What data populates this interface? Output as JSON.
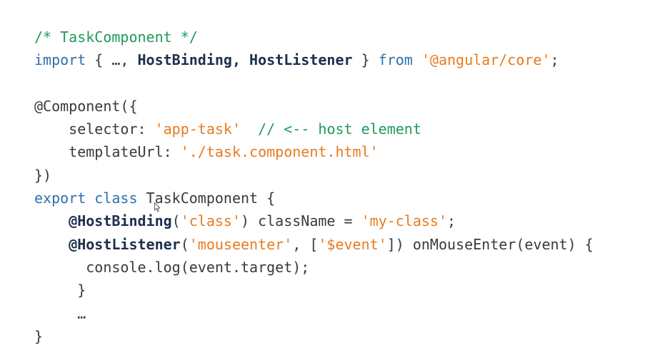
{
  "code": {
    "l1": {
      "comment": "/* TaskComponent */"
    },
    "l2": {
      "kw_import": "import",
      "brace_open": " { …, ",
      "host_binding": "HostBinding",
      "comma": ", ",
      "host_listener": "HostListener",
      "brace_close": " } ",
      "kw_from": "from",
      "space": " ",
      "module": "'@angular/core'",
      "semi": ";"
    },
    "l4": {
      "text": "@Component({"
    },
    "l5": {
      "indent": "    ",
      "key": "selector: ",
      "value": "'app-task'",
      "gap": "  ",
      "comment": "// <-- host element"
    },
    "l6": {
      "indent": "    ",
      "key": "templateUrl: ",
      "value": "'./task.component.html'"
    },
    "l7": {
      "text": "})"
    },
    "l8": {
      "kw_export": "export",
      "space1": " ",
      "kw_class": "class",
      "rest": " TaskComponent {"
    },
    "l9": {
      "indent": "    ",
      "decorator": "@HostBinding",
      "paren_open": "(",
      "arg": "'class'",
      "mid": ") className = ",
      "value": "'my-class'",
      "semi": ";"
    },
    "l10": {
      "indent": "    ",
      "decorator": "@HostListener",
      "paren_open": "(",
      "arg1": "'mouseenter'",
      "mid": ", [",
      "arg2": "'$event'",
      "rest": "]) onMouseEnter(event) {"
    },
    "l11": {
      "text": "      console.log(event.target);"
    },
    "l12": {
      "text": "     }"
    },
    "l13": {
      "text": "     …"
    },
    "l14": {
      "text": "}"
    }
  }
}
